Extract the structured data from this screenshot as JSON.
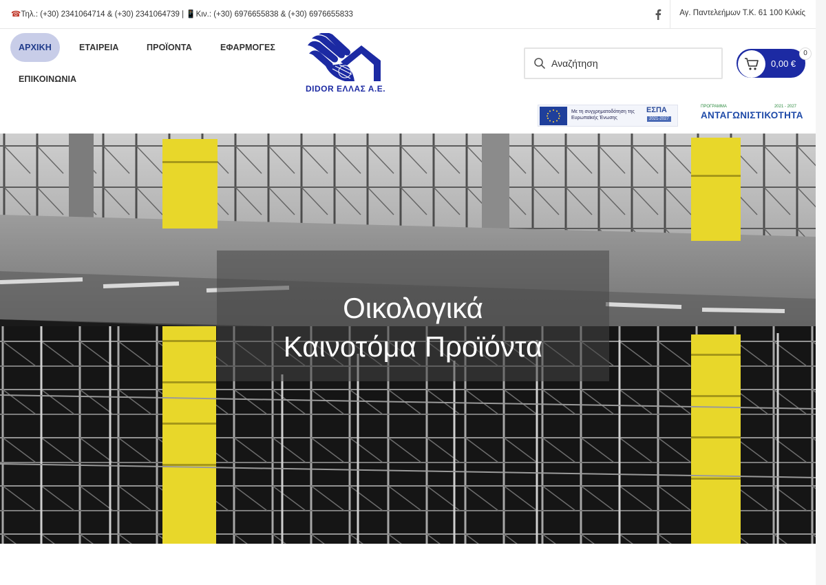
{
  "topbar": {
    "phone_icon": "phone-icon",
    "contacts_text": "Τηλ.: (+30) 2341064714  &  (+30) 2341064739 | ",
    "mobile_icon": "mobile-icon",
    "mobile_text": "Κιν.: (+30) 6976655838 & (+30) 6976655833",
    "social_icon": "facebook-icon",
    "address": "Αγ. Παντελεήμων Τ.Κ. 61 100 Κιλκίς"
  },
  "nav": {
    "items": [
      {
        "label": "ΑΡΧΙΚΗ",
        "active": true
      },
      {
        "label": "ΕΤΑΙΡΕΙΑ",
        "active": false
      },
      {
        "label": "ΠΡΟΪΟΝΤΑ",
        "active": false
      },
      {
        "label": "ΕΦΑΡΜΟΓΕΣ",
        "active": false
      },
      {
        "label": "ΕΠΙΚΟΙΝΩΝΙΑ",
        "active": false
      }
    ],
    "active_color": "#c8cde8"
  },
  "logo": {
    "text": "DIDOR ΕΛΛΑΣ Α.Ε.",
    "color": "#1c2aa3"
  },
  "search": {
    "placeholder": "Αναζήτηση",
    "icon": "search-icon"
  },
  "cart": {
    "amount": "0,00 €",
    "count": "0",
    "icon": "cart-icon",
    "color": "#1c2aa3"
  },
  "banners": {
    "espa_caption": "Με τη συγχρηματοδότηση της Ευρωπαϊκής Ένωσης",
    "espa_logo": "ΕΣΠΑ",
    "espa_years": "2021-2027",
    "antag_small": "ΠΡΟΓΡΑΜΜΑ",
    "antag_years": "2021 - 2027",
    "antag_title": "ΑΝΤΑΓΩΝΙΣΤΙΚΟΤΗΤΑ"
  },
  "hero": {
    "headline_line1": "Οικολογικά",
    "headline_line2": "Καινοτόμα Προϊόντα",
    "accent_color": "#e8d72a"
  }
}
